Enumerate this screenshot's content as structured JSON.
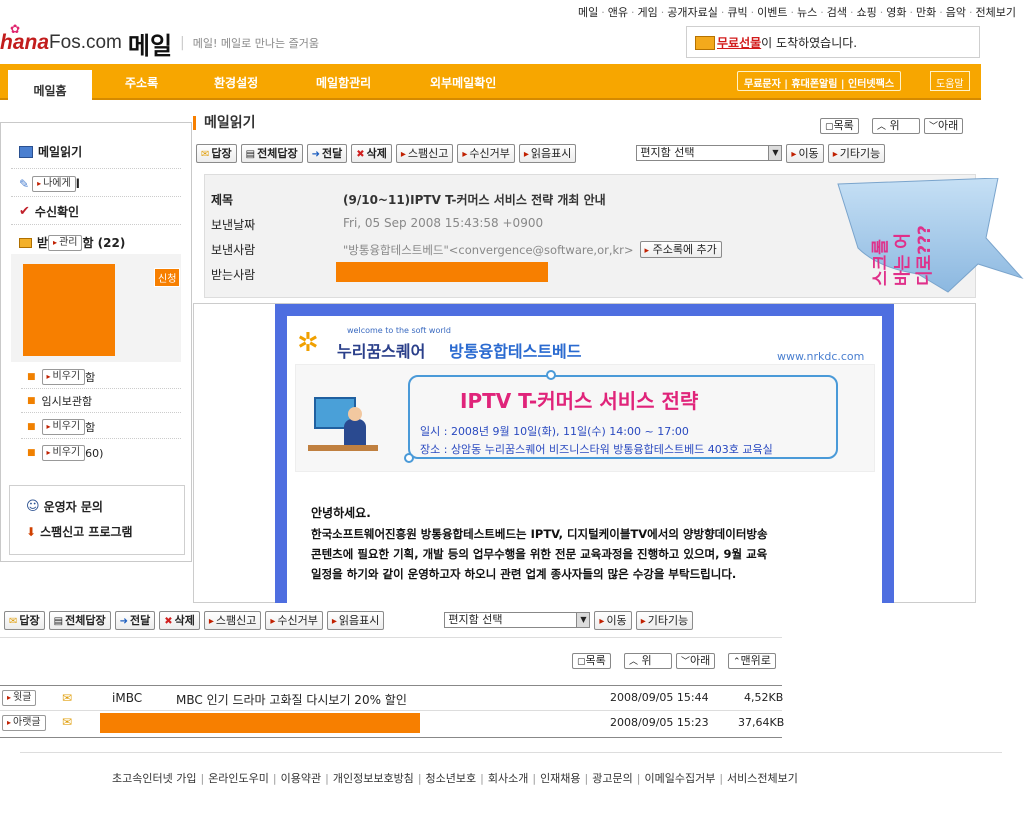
{
  "top_nav": [
    "메일",
    "앤유",
    "게임",
    "공개자료실",
    "큐빅",
    "이벤트",
    "뉴스",
    "검색",
    "쇼핑",
    "영화",
    "만화",
    "음악",
    "전체보기"
  ],
  "logo": {
    "hana": "hana",
    "fos": "Fos.com",
    "mail": "메일",
    "tagline": "메일! 메일로 만나는 즐거움"
  },
  "notice": {
    "gift": "무료선물",
    "text": "이 도착하였습니다."
  },
  "tabs": [
    "메일홈",
    "주소록",
    "환경설정",
    "메일함관리",
    "외부메일확인"
  ],
  "tab_right": {
    "services": "무료문자 | 휴대폰알림 | 인터넷팩스",
    "help": "도움말"
  },
  "sidebar": {
    "read_mail": "메일읽기",
    "to_me_btn": "나에게",
    "receipt": "수신확인",
    "inbox_prefix": "받",
    "manage_btn": "관리",
    "inbox_suffix": "함 (22)",
    "new_badge": "신청",
    "sub1_btn": "비우기",
    "sub1_suffix": "함",
    "sub2": "임시보관함",
    "sub3_btn": "비우기",
    "sub3_suffix": "함",
    "sub4_btn": "비우기",
    "sub4_suffix": "60)",
    "operator": "운영자 문의",
    "spam": "스팸신고 프로그램"
  },
  "read_title": "메일읽기",
  "nav_buttons": {
    "list": "목록",
    "up": "위",
    "down": "아래",
    "top": "맨위로"
  },
  "toolbar": {
    "reply": "답장",
    "reply_all": "전체답장",
    "forward": "전달",
    "delete": "삭제",
    "spam": "스팸신고",
    "block": "수신거부",
    "read": "읽음표시",
    "select": "편지함 선택",
    "move": "이동",
    "more": "기타기능"
  },
  "headers": {
    "subject_label": "제목",
    "subject": "(9/10~11)IPTV T-커머스 서비스 전략 개최 안내",
    "date_label": "보낸날짜",
    "date": "Fri, 05 Sep 2008 15:43:58 +0900",
    "from_label": "보낸사람",
    "from": "\"방통융합테스트베드\"<convergence@software,or,kr>",
    "add_addr": "주소록에 추가",
    "to_label": "받는사람"
  },
  "callout_lines": [
    "스크롤",
    "바는 어",
    "디로???"
  ],
  "mail": {
    "welcome": "welcome to the soft world",
    "brand1": "누리꿈스퀘어",
    "brand2": "방통융합테스트베드",
    "url": "www.nrkdc.com",
    "headline": "IPTV T-커머스 서비스 전략",
    "date_line": "일시 : 2008년 9월 10일(화), 11일(수) 14:00 ~ 17:00",
    "place_line": "장소 : 상암동 누리꿈스퀘어 비즈니스타워 방통융합테스트베드 403호 교육실",
    "greeting": "안녕하세요.",
    "body1": "한국소프트웨어진흥원 방통융합테스트베드는 IPTV, 디지털케이블TV에서의 양방향데이터방송",
    "body2": "콘텐츠에 필요한 기획, 개발 등의 업무수행을 위한 전문 교육과정을 진행하고 있으며, 9월 교육",
    "body3": "일정을 하기와 같이 운영하고자 하오니 관련 업계 종사자들의 많은 수강을 부탁드립니다."
  },
  "list": [
    {
      "btn": "윗글",
      "sender": "iMBC",
      "subject": "MBC 인기 드라마 고화질 다시보기 20% 할인",
      "date": "2008/09/05 15:44",
      "size": "4,52KB"
    },
    {
      "btn": "아랫글",
      "sender": "",
      "subject": "",
      "date": "2008/09/05 15:23",
      "size": "37,64KB"
    }
  ],
  "footer": [
    "초고속인터넷 가입",
    "온라인도우미",
    "이용약관",
    "개인정보보호방침",
    "청소년보호",
    "회사소개",
    "인재채용",
    "광고문의",
    "이메일수집거부",
    "서비스전체보기"
  ],
  "colors": {
    "tab_orange": "#f7a600",
    "redact_orange": "#f77f00",
    "mail_border": "#4e6ee0",
    "callout": "#9fc6e8"
  }
}
